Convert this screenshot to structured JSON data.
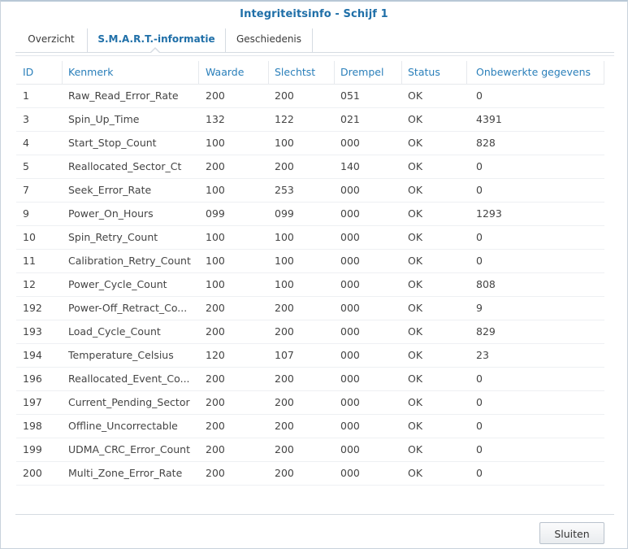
{
  "dialog": {
    "title": "Integriteitsinfo - Schijf 1"
  },
  "tabs": [
    {
      "label": "Overzicht",
      "active": false
    },
    {
      "label": "S.M.A.R.T.-informatie",
      "active": true
    },
    {
      "label": "Geschiedenis",
      "active": false
    }
  ],
  "table": {
    "columns": [
      "ID",
      "Kenmerk",
      "Waarde",
      "Slechtst",
      "Drempel",
      "Status",
      "Onbewerkte gegevens"
    ],
    "rows": [
      [
        "1",
        "Raw_Read_Error_Rate",
        "200",
        "200",
        "051",
        "OK",
        "0"
      ],
      [
        "3",
        "Spin_Up_Time",
        "132",
        "122",
        "021",
        "OK",
        "4391"
      ],
      [
        "4",
        "Start_Stop_Count",
        "100",
        "100",
        "000",
        "OK",
        "828"
      ],
      [
        "5",
        "Reallocated_Sector_Ct",
        "200",
        "200",
        "140",
        "OK",
        "0"
      ],
      [
        "7",
        "Seek_Error_Rate",
        "100",
        "253",
        "000",
        "OK",
        "0"
      ],
      [
        "9",
        "Power_On_Hours",
        "099",
        "099",
        "000",
        "OK",
        "1293"
      ],
      [
        "10",
        "Spin_Retry_Count",
        "100",
        "100",
        "000",
        "OK",
        "0"
      ],
      [
        "11",
        "Calibration_Retry_Count",
        "100",
        "100",
        "000",
        "OK",
        "0"
      ],
      [
        "12",
        "Power_Cycle_Count",
        "100",
        "100",
        "000",
        "OK",
        "808"
      ],
      [
        "192",
        "Power-Off_Retract_Co...",
        "200",
        "200",
        "000",
        "OK",
        "9"
      ],
      [
        "193",
        "Load_Cycle_Count",
        "200",
        "200",
        "000",
        "OK",
        "829"
      ],
      [
        "194",
        "Temperature_Celsius",
        "120",
        "107",
        "000",
        "OK",
        "23"
      ],
      [
        "196",
        "Reallocated_Event_Co...",
        "200",
        "200",
        "000",
        "OK",
        "0"
      ],
      [
        "197",
        "Current_Pending_Sector",
        "200",
        "200",
        "000",
        "OK",
        "0"
      ],
      [
        "198",
        "Offline_Uncorrectable",
        "200",
        "200",
        "000",
        "OK",
        "0"
      ],
      [
        "199",
        "UDMA_CRC_Error_Count",
        "200",
        "200",
        "000",
        "OK",
        "0"
      ],
      [
        "200",
        "Multi_Zone_Error_Rate",
        "200",
        "200",
        "000",
        "OK",
        "0"
      ]
    ]
  },
  "footer": {
    "close_label": "Sluiten"
  },
  "colors": {
    "accent": "#1f6fa8",
    "header_text": "#2a7fba",
    "body_text": "#444444"
  }
}
